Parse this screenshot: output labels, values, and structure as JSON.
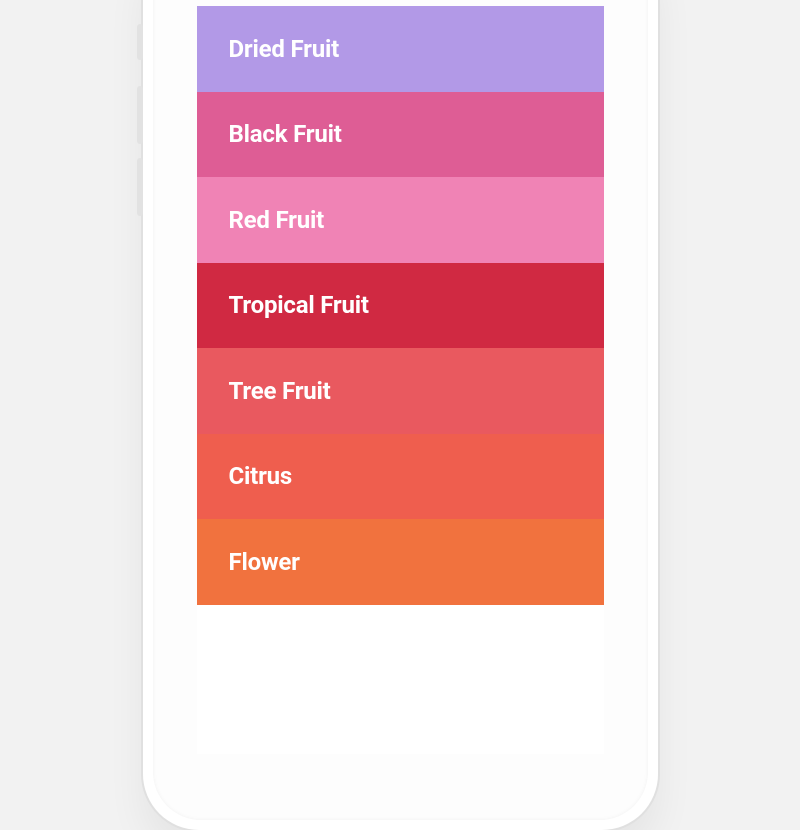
{
  "list": {
    "items": [
      {
        "label": "Dried Fruit",
        "color": "#B299E7"
      },
      {
        "label": "Black Fruit",
        "color": "#DE5D95"
      },
      {
        "label": "Red Fruit",
        "color": "#F083B5"
      },
      {
        "label": "Tropical Fruit",
        "color": "#D02942"
      },
      {
        "label": "Tree Fruit",
        "color": "#E9595F"
      },
      {
        "label": "Citrus",
        "color": "#EF5E4E"
      },
      {
        "label": "Flower",
        "color": "#F1723E"
      }
    ]
  }
}
